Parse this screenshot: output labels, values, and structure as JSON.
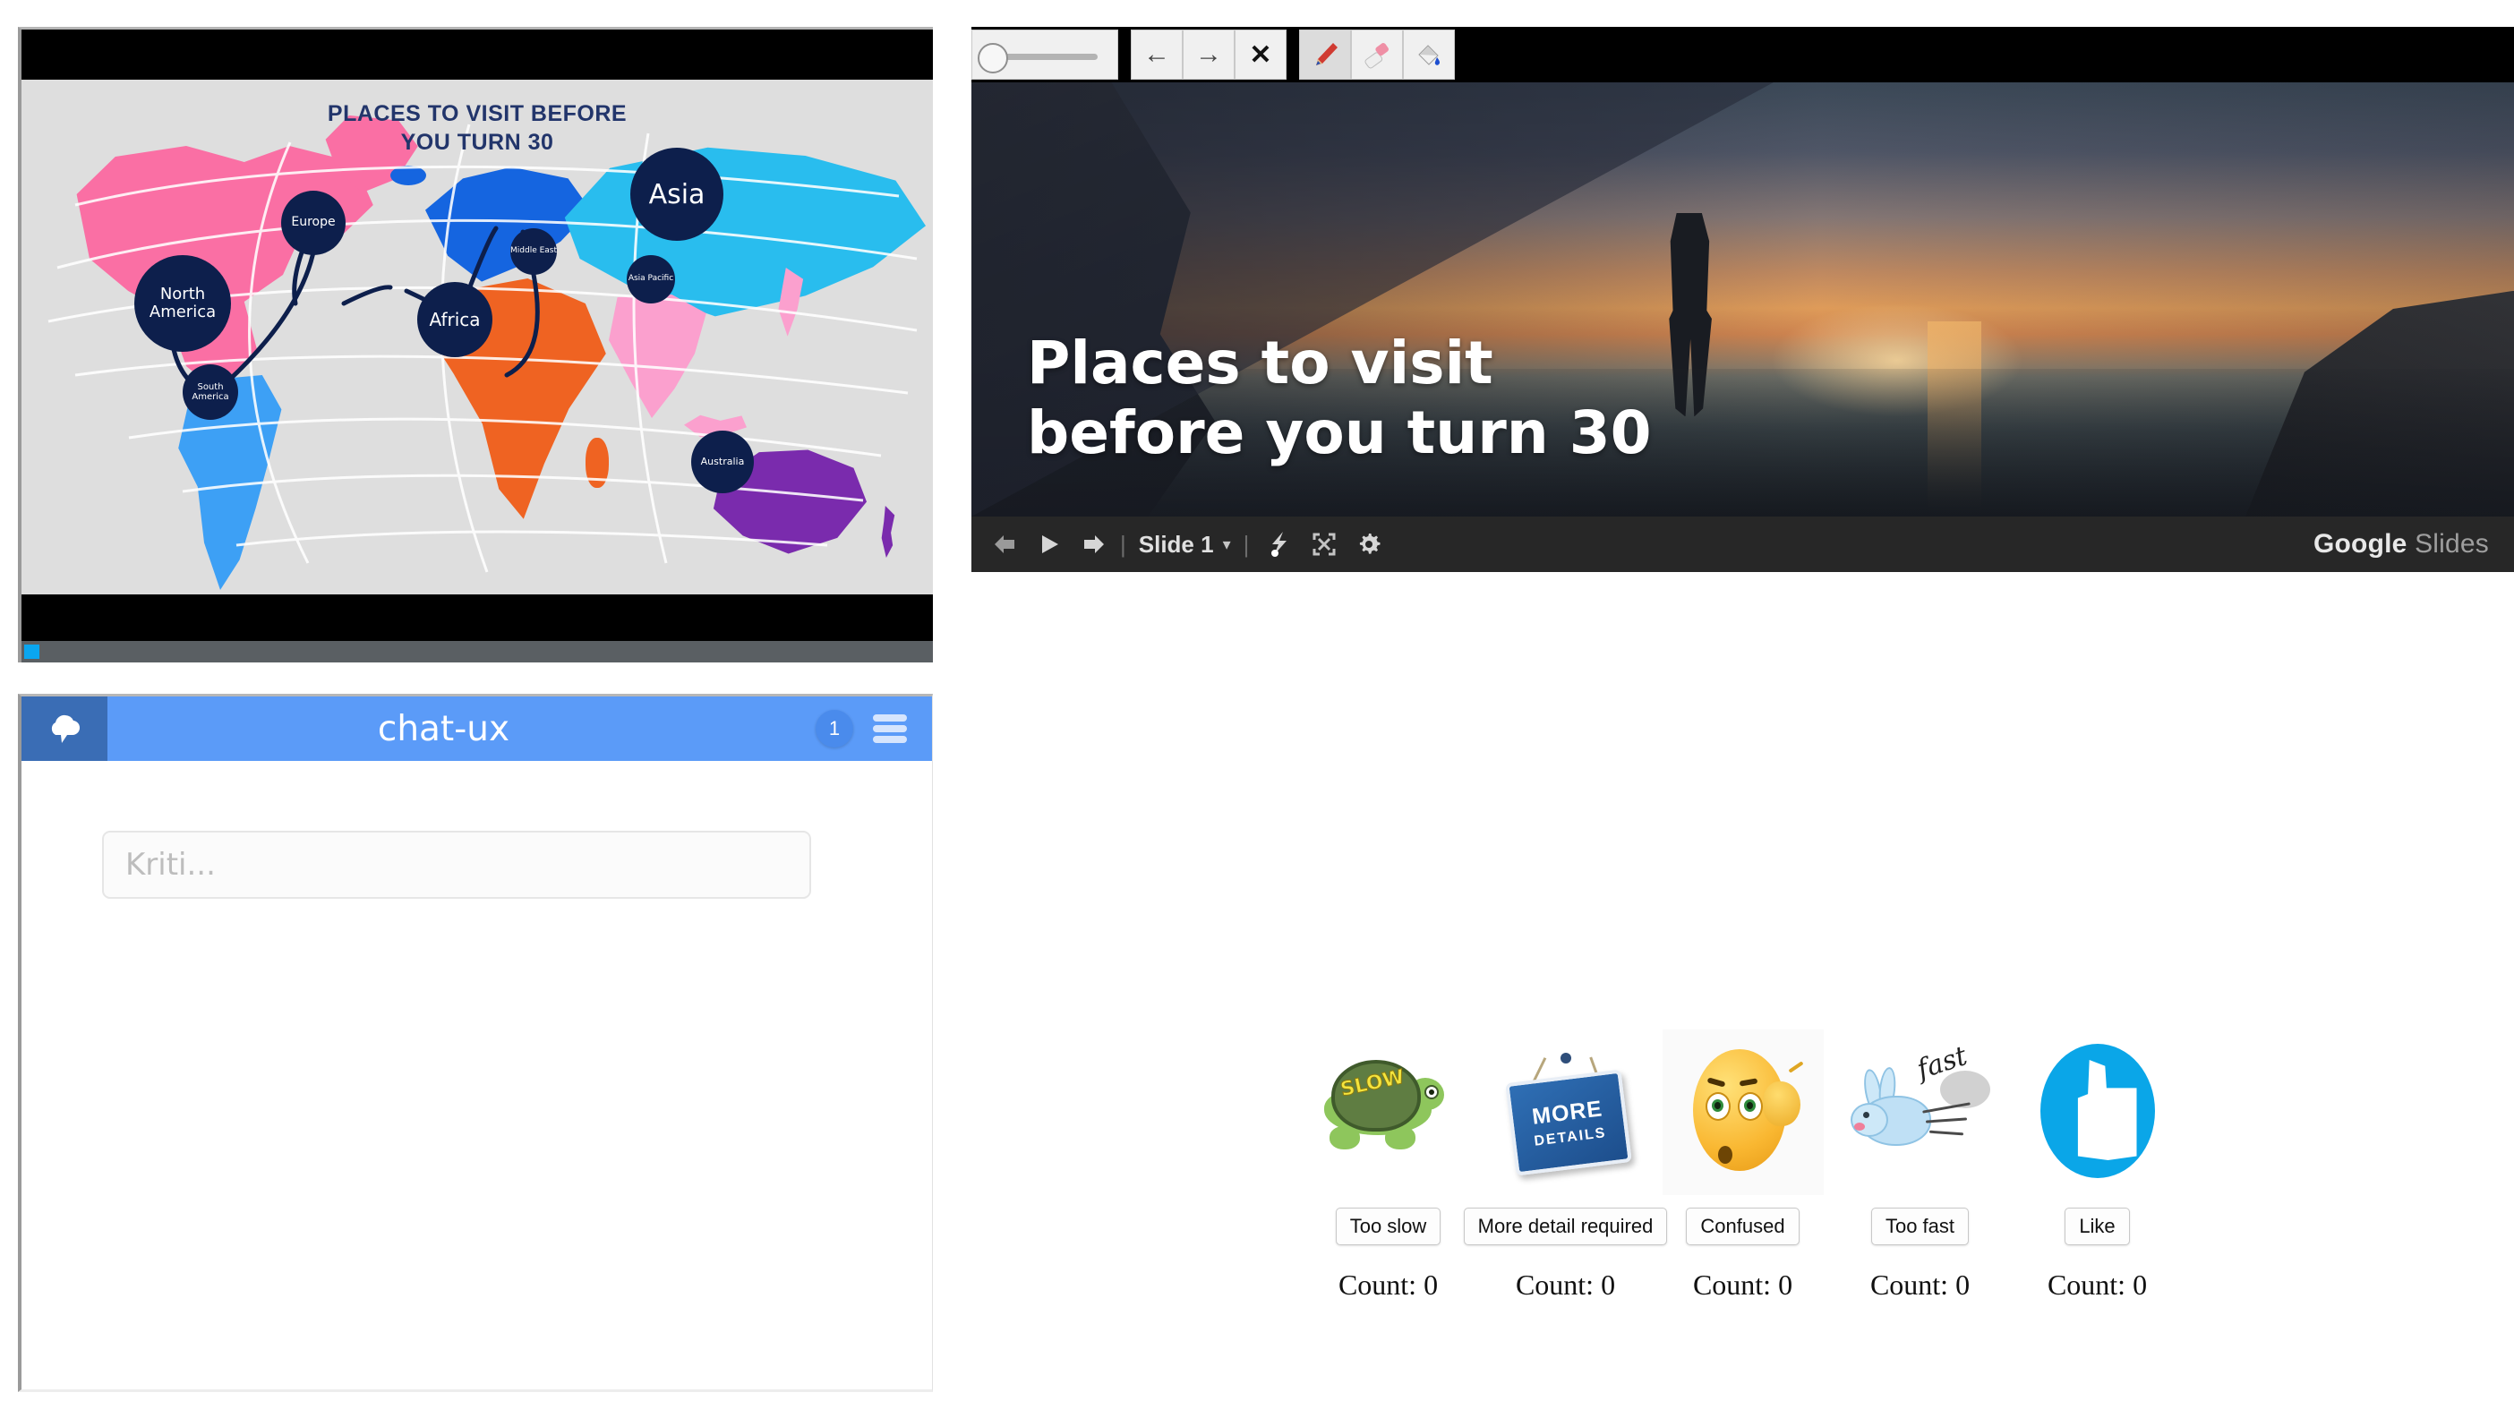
{
  "slide_thumbnail": {
    "title_line1": "PLACES TO VISIT BEFORE",
    "title_line2": "YOU TURN 30",
    "map_nodes": [
      {
        "label": "North America",
        "color": "#0d1f4c"
      },
      {
        "label": "South America",
        "color": "#0d1f4c"
      },
      {
        "label": "Europe",
        "color": "#0d1f4c"
      },
      {
        "label": "Africa",
        "color": "#0d1f4c"
      },
      {
        "label": "Middle East",
        "color": "#0d1f4c"
      },
      {
        "label": "Asia",
        "color": "#0d1f4c"
      },
      {
        "label": "Asia Pacific",
        "color": "#0d1f4c"
      },
      {
        "label": "Australia",
        "color": "#0d1f4c"
      }
    ],
    "region_colors": {
      "north_america": "#fa6fa4",
      "south_america": "#3da0f5",
      "europe": "#1565e0",
      "africa": "#ef6322",
      "asia": "#29bdee",
      "asia_pacific": "#fba0ce",
      "australia": "#7a2bad"
    }
  },
  "chat": {
    "logo_icon": "cloud-icon",
    "title": "chat-ux",
    "badge_count": "1",
    "menu_icon": "hamburger-menu-icon",
    "input_placeholder": "Kriti...",
    "input_value": ""
  },
  "draw_toolbar": {
    "slider_label": "brush-size-slider",
    "buttons": [
      {
        "name": "undo-button",
        "glyph": "←"
      },
      {
        "name": "redo-button",
        "glyph": "→"
      },
      {
        "name": "close-button",
        "glyph": "✕"
      }
    ],
    "tools": [
      {
        "name": "pen-tool-button",
        "label": "pen",
        "active": true
      },
      {
        "name": "eraser-tool-button",
        "label": "eraser",
        "active": false
      },
      {
        "name": "fill-tool-button",
        "label": "paint-bucket",
        "active": false
      }
    ]
  },
  "presentation": {
    "title": "Places to visit before you turn 30",
    "control_bar": {
      "prev_icon": "previous-slide-icon",
      "play_icon": "play-icon",
      "next_icon": "next-slide-icon",
      "slide_label": "Slide 1",
      "caret": "▾",
      "laser_icon": "laser-pointer-icon",
      "fullscreen_icon": "fullscreen-icon",
      "settings_icon": "gear-icon"
    },
    "brand": {
      "primary": "Google",
      "secondary": "Slides"
    }
  },
  "reactions": {
    "items": [
      {
        "art": "turtle-slow-icon",
        "art_text": "SLOW",
        "label": "Too slow",
        "count_text": "Count: 0"
      },
      {
        "art": "more-details-sign-icon",
        "art_text_1": "MORE",
        "art_text_2": "DETAILS",
        "label": "More detail required",
        "count_text": "Count: 0"
      },
      {
        "art": "confused-emoji-icon",
        "label": "Confused",
        "count_text": "Count: 0"
      },
      {
        "art": "fast-rabbit-icon",
        "art_text": "fast",
        "label": "Too fast",
        "count_text": "Count: 0"
      },
      {
        "art": "thumbs-up-icon",
        "label": "Like",
        "count_text": "Count: 0"
      }
    ]
  },
  "colors": {
    "chat_header": "#5b9bf8",
    "chat_logo_bg": "#3a6db5",
    "slides_bar": "#272727",
    "accent_blue": "#0aa6e8"
  }
}
